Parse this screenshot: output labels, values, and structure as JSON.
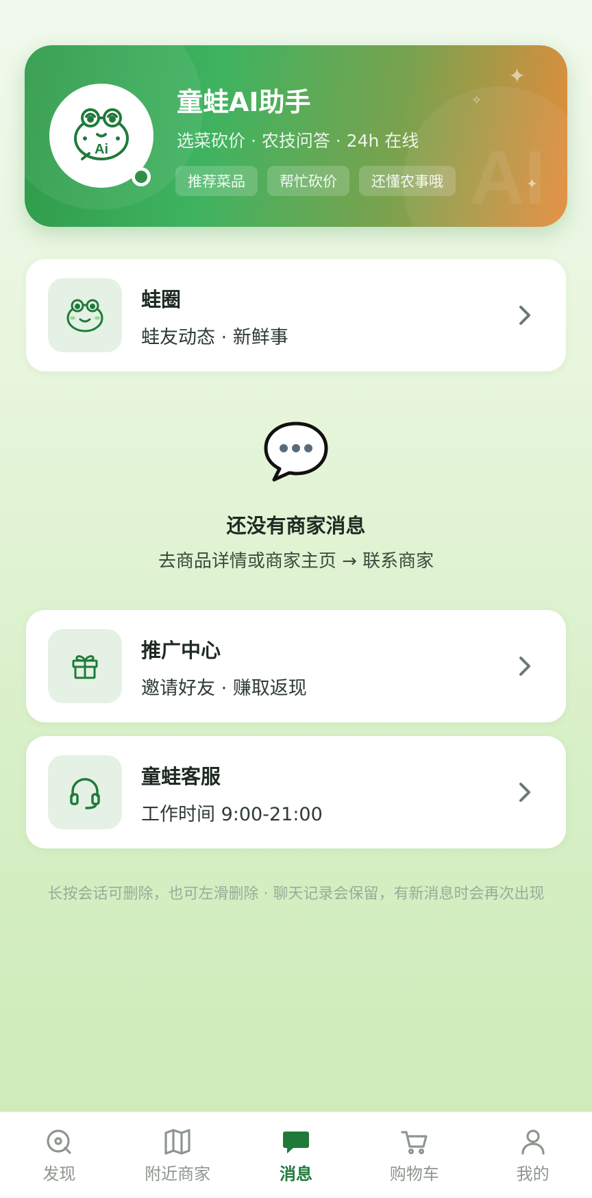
{
  "ai_card": {
    "title": "童蛙AI助手",
    "subtitle": "选菜砍价 · 农技问答 · 24h 在线",
    "chips": [
      "推荐菜品",
      "帮忙砍价",
      "还懂农事哦"
    ],
    "avatar_icon": "frog-ai-icon",
    "watermark": "AI"
  },
  "cards": [
    {
      "title": "蛙圈",
      "subtitle": "蛙友动态 · 新鲜事",
      "icon": "frog-icon"
    },
    {
      "title": "推广中心",
      "subtitle": "邀请好友 · 赚取返现",
      "icon": "gift-icon"
    },
    {
      "title": "童蛙客服",
      "subtitle": "工作时间 9:00-21:00",
      "icon": "headset-icon"
    }
  ],
  "empty_state": {
    "icon": "chat-bubble-icon",
    "title": "还没有商家消息",
    "subtitle": "去商品详情或商家主页 → 联系商家"
  },
  "hint": "长按会话可删除，也可左滑删除 · 聊天记录会保留，有新消息时会再次出现",
  "tabbar": {
    "active": "消息",
    "tabs": [
      {
        "label": "发现",
        "icon": "discover-icon"
      },
      {
        "label": "附近商家",
        "icon": "map-icon"
      },
      {
        "label": "消息",
        "icon": "message-icon"
      },
      {
        "label": "购物车",
        "icon": "cart-icon"
      },
      {
        "label": "我的",
        "icon": "profile-icon"
      }
    ]
  },
  "colors": {
    "primary_green": "#1f7a3a",
    "card_gradient_start": "#2e9a49",
    "card_gradient_end": "#e58c3c",
    "icon_box_bg": "#e4f1e4"
  }
}
